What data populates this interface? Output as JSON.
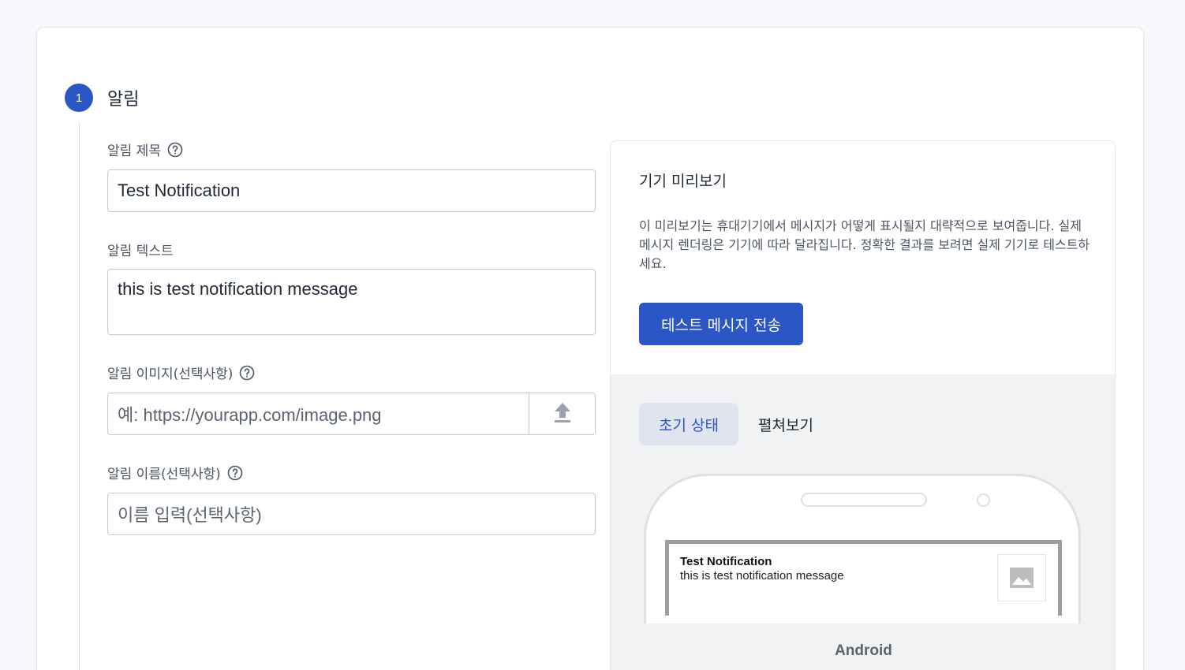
{
  "step": {
    "number": "1",
    "title": "알림"
  },
  "form": {
    "title_label": "알림 제목",
    "title_value": "Test Notification",
    "text_label": "알림 텍스트",
    "text_value": "this is test notification message",
    "image_label": "알림 이미지(선택사항)",
    "image_placeholder": "예: https://yourapp.com/image.png",
    "name_label": "알림 이름(선택사항)",
    "name_placeholder": "이름 입력(선택사항)"
  },
  "preview": {
    "title": "기기 미리보기",
    "description": "이 미리보기는 휴대기기에서 메시지가 어떻게 표시될지 대략적으로 보여줍니다. 실제 메시지 렌더링은 기기에 따라 달라집니다. 정확한 결과를 보려면 실제 기기로 테스트하세요.",
    "send_button": "테스트 메시지 전송",
    "tabs": [
      {
        "label": "초기 상태",
        "active": true
      },
      {
        "label": "펼쳐보기",
        "active": false
      }
    ],
    "notification": {
      "title": "Test Notification",
      "body": "this is test notification message"
    },
    "platform": "Android"
  },
  "colors": {
    "accent": "#2a56c6",
    "tab_active_bg": "#dfe4ef",
    "preview_bg": "#f1f2f4"
  },
  "icons": {
    "help": "help-circle-icon",
    "upload": "upload-icon",
    "image": "image-placeholder-icon"
  }
}
